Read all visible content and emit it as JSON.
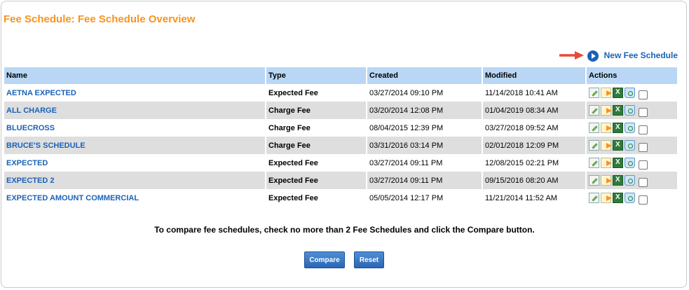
{
  "page": {
    "title": "Fee Schedule: Fee Schedule Overview"
  },
  "new_fee_schedule": {
    "label": "New Fee Schedule"
  },
  "table": {
    "headers": {
      "name": "Name",
      "type": "Type",
      "created": "Created",
      "modified": "Modified",
      "actions": "Actions"
    },
    "rows": [
      {
        "name": "AETNA EXPECTED",
        "type": "Expected Fee",
        "created": "03/27/2014 09:10 PM",
        "modified": "11/14/2018 10:41 AM"
      },
      {
        "name": "ALL CHARGE",
        "type": "Charge Fee",
        "created": "03/20/2014 12:08 PM",
        "modified": "01/04/2019 08:34 AM"
      },
      {
        "name": "BLUECROSS",
        "type": "Charge Fee",
        "created": "08/04/2015 12:39 PM",
        "modified": "03/27/2018 09:52 AM"
      },
      {
        "name": "BRUCE'S SCHEDULE",
        "type": "Charge Fee",
        "created": "03/31/2016 03:14 PM",
        "modified": "02/01/2018 12:09 PM"
      },
      {
        "name": "EXPECTED",
        "type": "Expected Fee",
        "created": "03/27/2014 09:11 PM",
        "modified": "12/08/2015 02:21 PM"
      },
      {
        "name": "EXPECTED 2",
        "type": "Expected Fee",
        "created": "03/27/2014 09:11 PM",
        "modified": "09/15/2016 08:20 AM"
      },
      {
        "name": "EXPECTED AMOUNT COMMERCIAL",
        "type": "Expected Fee",
        "created": "05/05/2014 12:17 PM",
        "modified": "11/21/2014 11:52 AM"
      }
    ]
  },
  "compare_note": "To compare fee schedules, check no more than 2 Fee Schedules and click the Compare button.",
  "buttons": {
    "compare": "Compare",
    "reset": "Reset"
  },
  "colors": {
    "title_orange": "#f7941d",
    "link_blue": "#1a62b7",
    "header_bg": "#b9d7f5",
    "alt_row": "#dedede",
    "button_blue": "#2a66b5",
    "callout_arrow": "#e8493a"
  },
  "icons": [
    "edit-icon",
    "copy-icon",
    "excel-export-icon",
    "delete-icon"
  ]
}
